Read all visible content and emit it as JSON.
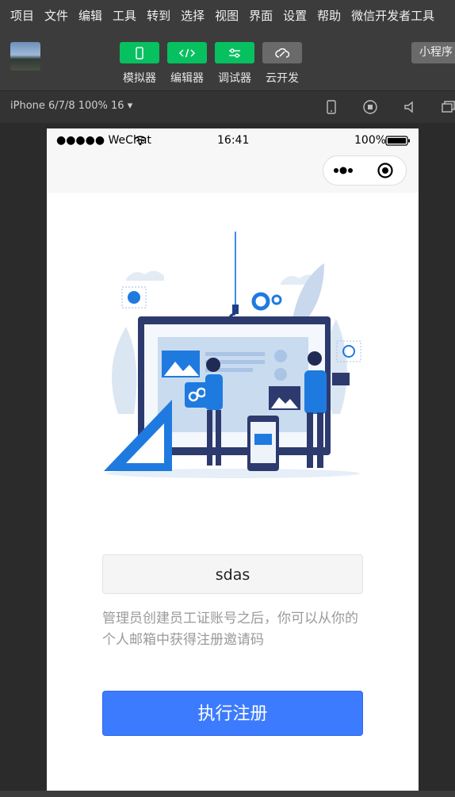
{
  "menubar": {
    "items": [
      "项目",
      "文件",
      "编辑",
      "工具",
      "转到",
      "选择",
      "视图",
      "界面",
      "设置",
      "帮助",
      "微信开发者工具"
    ]
  },
  "toolbar": {
    "simulator_label": "模拟器",
    "editor_label": "编辑器",
    "debugger_label": "调试器",
    "cloud_label": "云开发",
    "miniprogram_label": "小程序",
    "accent_green": "#07c160"
  },
  "devicebar": {
    "device_label": "iPhone 6/7/8 100% 16 ▾"
  },
  "phone": {
    "status": {
      "carrier": "●●●●● WeChat",
      "time": "16:41",
      "battery": "100%"
    },
    "form": {
      "invite_code_value": "sdas",
      "hint": "管理员创建员工证账号之后，你可以从你的个人邮箱中获得注册邀请码",
      "submit_label": "执行注册",
      "button_color": "#3c7bfd"
    }
  }
}
